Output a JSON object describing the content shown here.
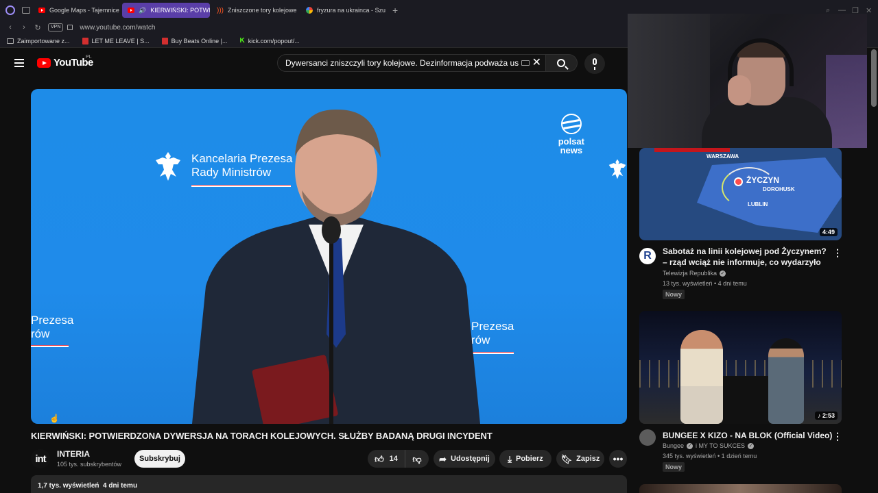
{
  "browser": {
    "tabs": [
      {
        "label": "Google Maps - Tajemnice",
        "icon": "youtube-favicon",
        "active": false
      },
      {
        "label": "KIERWIŃSKI: POTWIE",
        "icon": "youtube-favicon",
        "active": true
      },
      {
        "label": "Zniszczone tory kolejowe",
        "icon": "radio-favicon",
        "active": false
      },
      {
        "label": "fryzura na ukrainca - Szu",
        "icon": "google-favicon",
        "active": false
      }
    ],
    "url": "www.youtube.com/watch",
    "vpn_label": "VPN",
    "bookmarks": [
      {
        "label": "Zaimportowane z...",
        "icon": "folder-icon"
      },
      {
        "label": "LET ME LEAVE | S...",
        "icon": "red-bookmark-icon"
      },
      {
        "label": "Buy Beats Online |...",
        "icon": "red-bookmark-icon"
      },
      {
        "label": "kick.com/popout/...",
        "icon": "kick-icon"
      }
    ]
  },
  "header": {
    "logo_text": "YouTube",
    "country_code": "PL",
    "search_value": "Dywersanci zniszczyli tory kolejowe. Dezinformacja podważa ust"
  },
  "player": {
    "wall_text_main_1": "Kancelaria Prezesa",
    "wall_text_main_2": "Rady Ministrów",
    "wall_text_left_1": "Prezesa",
    "wall_text_left_2": "rów",
    "wall_text_right_1": "Prezesa",
    "wall_text_right_2": "rów",
    "broadcaster_1": "polsat",
    "broadcaster_2": "news"
  },
  "video": {
    "title": "KIERWIŃSKI: POTWIERDZONA DYWERSJA NA TORACH KOLEJOWYCH. SŁUŻBY BADANĄ DRUGI INCYDENT",
    "channel_avatar_text": "int",
    "channel_name": "INTERIA",
    "subscribers": "105 tys. subskrybentów",
    "subscribe_label": "Subskrybuj",
    "likes": "14",
    "share_label": "Udostępnij",
    "download_label": "Pobierz",
    "save_label": "Zapisz",
    "views_date": "1,7 tys. wyświetleń  4 dni temu"
  },
  "sidebar": {
    "items": [
      {
        "title": "Sabotaż na linii kolejowej pod Życzynem? – rząd wciąż nie informuje, co wydarzyło się n...",
        "channel": "Telewizja Republika",
        "meta": "13 tys. wyświetleń • 4 dni temu",
        "badge": "Nowy",
        "duration": "4:49",
        "avatar_text": "R",
        "map_labels": {
          "warszawa": "WARSZAWA",
          "zyczyn": "ŻYCZYN",
          "dorohusk": "DOROHUSK",
          "lublin": "LUBLIN"
        }
      },
      {
        "title": "BUNGEE X KIZO - NA BLOK (Official Video)",
        "channel": "Bungee",
        "channel_extra": "i MY TO SUKCES",
        "meta": "345 tys. wyświetleń • 1 dzień temu",
        "badge": "Nowy",
        "duration": "2:53"
      }
    ]
  },
  "colors": {
    "player_bg": "#1f8bea",
    "youtube_red": "#ff0000",
    "active_tab": "#5a3ea8",
    "page_bg": "#0f0f0f"
  }
}
